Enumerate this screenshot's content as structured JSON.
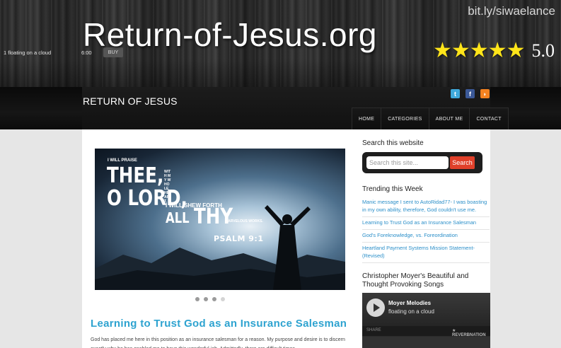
{
  "banner": {
    "title": "Return-of-Jesus.org",
    "short_link": "bit.ly/siwaelance",
    "stars": "★★★★★",
    "rating": "5.0"
  },
  "header": {
    "brand": "RETURN OF JESUS",
    "social": [
      "twitter-icon",
      "facebook-icon",
      "rss-icon"
    ],
    "nav": [
      "HOME",
      "CATEGORIES",
      "ABOUT ME",
      "CONTACT"
    ]
  },
  "slider": {
    "line1": "I WILL PRAISE",
    "line2": "THEE,",
    "line3": "O LORD,",
    "line4": "WITH MY WHOLE HEART,",
    "line5": "I WILL SHEW FORTH",
    "line6": "ALL",
    "line7": "THY",
    "line8": "MARVELOUS WORKS.",
    "ref": "PSALM 9:1",
    "dots": 4,
    "active_dot": 3
  },
  "post": {
    "title": "Learning to Trust God as an Insurance Salesman",
    "excerpt": "God has placed me here in this position as an insurance salesman for a reason.  My purpose and desire is to discern exactly why he has enabled me to have this wonderful job.  Admittedly, there are difficult times"
  },
  "sidebar": {
    "search_title": "Search this website",
    "search_placeholder": "Search this site...",
    "search_button": "Search",
    "trending_title": "Trending this Week",
    "trending": [
      "Manic message I sent to AutoRidad77- I was boasting in my own ability, therefore, God couldn't use me.",
      "Learning to Trust God as an Insurance Salesman",
      "God's Foreknowledge, vs. Foreordination",
      "Heartland Payment Systems Mission Statement- (Revised)"
    ],
    "songs_title": "Christopher Moyer's Beautiful and Thought Provoking Songs",
    "player": {
      "artist": "Moyer Melodies",
      "subtitle": "floating on a cloud",
      "share": "SHARE",
      "brand": "★ REVERBNATION",
      "track": "1 floating on a cloud",
      "time": "6:00",
      "buy": "BUY"
    }
  }
}
